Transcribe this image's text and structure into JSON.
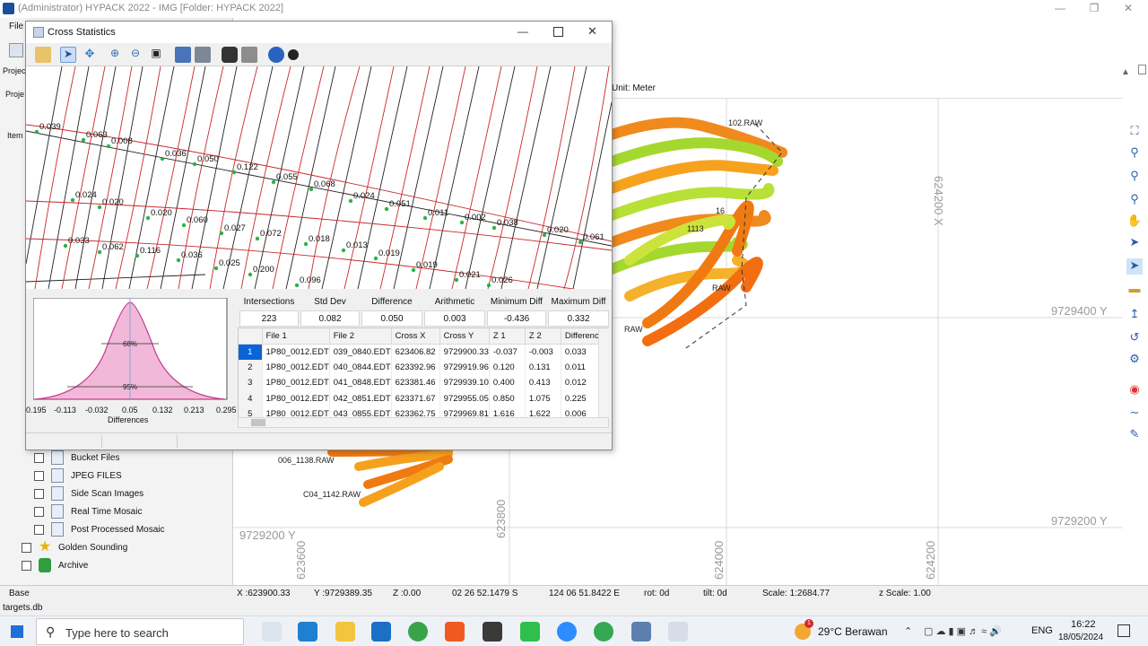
{
  "main_window": {
    "title": "(Administrator) HYPACK 2022 - IMG  [Folder: HYPACK 2022]",
    "menu_file": "File",
    "tab_project": "Projec",
    "tab_project2": "Proje",
    "tab_items": "Item"
  },
  "tree_items": [
    {
      "label": "Bucket Files"
    },
    {
      "label": "JPEG FILES"
    },
    {
      "label": "Side Scan Images"
    },
    {
      "label": "Real Time Mosaic"
    },
    {
      "label": "Post Processed Mosaic"
    },
    {
      "label": "Golden Sounding"
    },
    {
      "label": "Archive"
    }
  ],
  "map": {
    "unit_label": "Unit: Meter",
    "y_labels": [
      "9729400 Y",
      "9729200 Y",
      "9729200 Y"
    ],
    "x_labels": [
      "624200 X",
      "623800",
      "624000",
      "624200",
      "623600"
    ],
    "line_labels": [
      "102.RAW",
      "006_1138.RAW",
      "C04_1142.RAW",
      "RAW",
      "RAW",
      "16",
      "1113"
    ]
  },
  "status_bar": {
    "base": "Base",
    "x": "X :623900.33",
    "y": "Y :9729389.35",
    "z": "Z :0.00",
    "lat": "02 26 52.1479 S",
    "lon": "124 06 51.8422 E",
    "rot": "rot:  0d",
    "tilt": "tilt:  0d",
    "scale": "Scale: 1:2684.77",
    "zscale": "z Scale: 1.00",
    "db": "targets.db"
  },
  "dialog": {
    "title": "Cross Statistics",
    "plot_values": [
      "0.039",
      "0.063",
      "0.008",
      "0.036",
      "0.050",
      "0.122",
      "0.055",
      "0.068",
      "0.024",
      "0.051",
      "0.011",
      "0.002",
      "0.038",
      "0.020",
      "0.061",
      "0.024",
      "0.020",
      "0.020",
      "0.060",
      "0.027",
      "0.072",
      "0.018",
      "0.013",
      "0.019",
      "0.019",
      "0.021",
      "0.026",
      "0.033",
      "0.062",
      "0.116",
      "0.036",
      "0.025",
      "0.200",
      "0.096"
    ],
    "histogram": {
      "label_68": "68%",
      "label_95": "95%",
      "x_ticks": [
        "0.195",
        "-0.113",
        "-0.032",
        "0.05",
        "0.132",
        "0.213",
        "0.295"
      ],
      "x_title": "Differences"
    },
    "stats": {
      "headers": [
        "Intersections",
        "Std Dev",
        "Difference Mean",
        "Arithmetic Mean",
        "Minimum Diff",
        "Maximum Diff"
      ],
      "values": [
        "223",
        "0.082",
        "0.050",
        "0.003",
        "-0.436",
        "0.332"
      ]
    },
    "table": {
      "columns": [
        "",
        "File 1",
        "File 2",
        "Cross X",
        "Cross Y",
        "Z 1",
        "Z 2",
        "Difference"
      ],
      "rows": [
        [
          "1",
          "1P80_0012.EDT",
          "039_0840.EDT",
          "623406.82",
          "9729900.33",
          "-0.037",
          "-0.003",
          "0.033"
        ],
        [
          "2",
          "1P80_0012.EDT",
          "040_0844.EDT",
          "623392.96",
          "9729919.96",
          "0.120",
          "0.131",
          "0.011"
        ],
        [
          "3",
          "1P80_0012.EDT",
          "041_0848.EDT",
          "623381.46",
          "9729939.10",
          "0.400",
          "0.413",
          "0.012"
        ],
        [
          "4",
          "1P80_0012.EDT",
          "042_0851.EDT",
          "623371.67",
          "9729955.05",
          "0.850",
          "1.075",
          "0.225"
        ],
        [
          "5",
          "1P80_0012.EDT",
          "043_0855.EDT",
          "623362.75",
          "9729969.81",
          "1.616",
          "1.622",
          "0.006"
        ]
      ]
    }
  },
  "taskbar": {
    "search_placeholder": "Type here to search",
    "weather": "29°C  Berawan",
    "lang": "ENG",
    "time": "16:22",
    "date": "18/05/2024",
    "weather_badge": "1"
  }
}
